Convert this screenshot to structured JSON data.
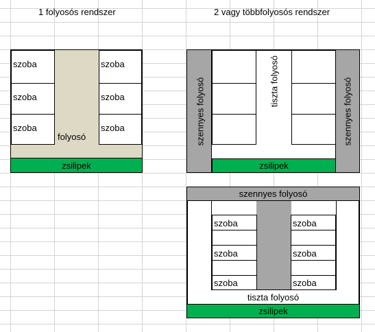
{
  "titles": {
    "left": "1 folyosós rendszer",
    "right": "2 vagy többfolyosós rendszer"
  },
  "left_diagram": {
    "room_label": "szoba",
    "corridor_label": "folyosó",
    "airlock_label": "zsilipek"
  },
  "right_top_diagram": {
    "dirty_corridor_label": "szennyes  folyosó",
    "clean_corridor_label": "tiszta folyosó",
    "airlock_label": "zsilipek"
  },
  "right_bottom_diagram": {
    "dirty_corridor_label": "szennyes folyosó",
    "room_label": "szoba",
    "clean_corridor_label": "tiszta folyosó",
    "airlock_label": "zsilipek"
  },
  "colors": {
    "beige_corridor": "#ddd9c4",
    "gray_corridor": "#a6a6a6",
    "airlock_green": "#00b050",
    "gridline": "#d4d4d4"
  }
}
